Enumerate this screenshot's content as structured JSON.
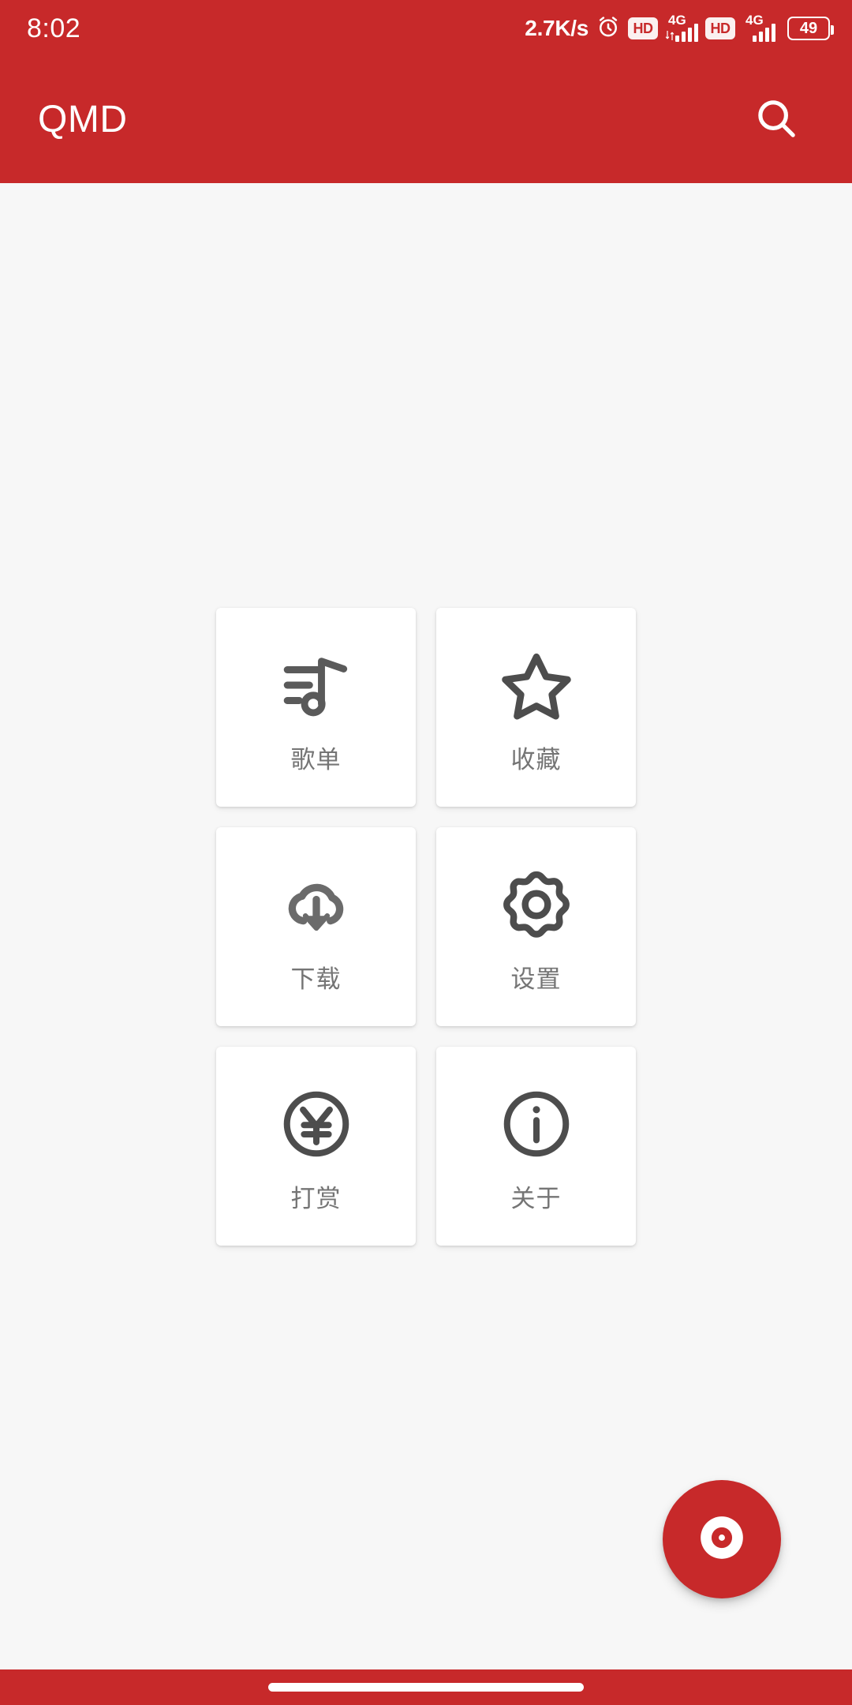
{
  "theme": {
    "primary": "#c7292a",
    "background": "#f7f7f7",
    "card": "#ffffff",
    "icon_gray": "#5a5a5a",
    "label_gray": "#757575",
    "on_primary": "#ffffff"
  },
  "status_bar": {
    "clock": "8:02",
    "network_speed": "2.7K/s",
    "alarm_icon": "alarm-clock-icon",
    "sim1": {
      "hd_label": "HD",
      "network_label": "4G",
      "signal_bars": 4
    },
    "sim2": {
      "hd_label": "HD",
      "network_label": "4G",
      "signal_bars": 4
    },
    "battery": {
      "level": "49",
      "icon": "battery-icon"
    }
  },
  "app_bar": {
    "title": "QMD",
    "search": {
      "label": "",
      "icon": "search-icon"
    }
  },
  "grid": {
    "items": [
      {
        "label": "歌单",
        "icon": "playlist-music-icon"
      },
      {
        "label": "收藏",
        "icon": "star-icon"
      },
      {
        "label": "下载",
        "icon": "cloud-download-icon"
      },
      {
        "label": "设置",
        "icon": "gear-icon"
      },
      {
        "label": "打赏",
        "icon": "yen-circle-icon"
      },
      {
        "label": "关于",
        "icon": "info-circle-icon"
      }
    ]
  },
  "fab": {
    "icon": "vinyl-record-icon",
    "label": ""
  },
  "nav_bar": {
    "gesture_pill": "home-gesture-bar"
  }
}
